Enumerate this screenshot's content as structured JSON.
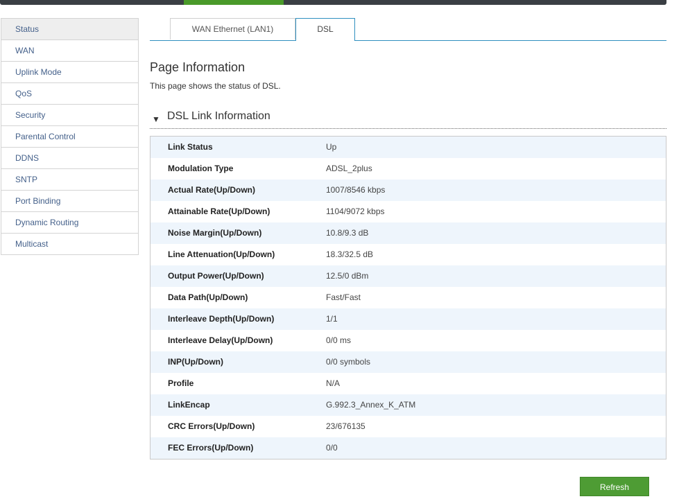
{
  "sidebar": {
    "items": [
      {
        "label": "Status"
      },
      {
        "label": "WAN"
      },
      {
        "label": "Uplink Mode"
      },
      {
        "label": "QoS"
      },
      {
        "label": "Security"
      },
      {
        "label": "Parental Control"
      },
      {
        "label": "DDNS"
      },
      {
        "label": "SNTP"
      },
      {
        "label": "Port Binding"
      },
      {
        "label": "Dynamic Routing"
      },
      {
        "label": "Multicast"
      }
    ]
  },
  "tabs": [
    {
      "label": "WAN Ethernet (LAN1)"
    },
    {
      "label": "DSL"
    }
  ],
  "page": {
    "title": "Page Information",
    "description": "This page shows the status of DSL."
  },
  "section": {
    "title": "DSL Link Information",
    "arrow": "▼"
  },
  "dsl_info": [
    {
      "label": "Link Status",
      "value": "Up"
    },
    {
      "label": "Modulation Type",
      "value": "ADSL_2plus"
    },
    {
      "label": "Actual Rate(Up/Down)",
      "value": "1007/8546 kbps"
    },
    {
      "label": "Attainable Rate(Up/Down)",
      "value": "1104/9072 kbps"
    },
    {
      "label": "Noise Margin(Up/Down)",
      "value": "10.8/9.3 dB"
    },
    {
      "label": "Line Attenuation(Up/Down)",
      "value": "18.3/32.5 dB"
    },
    {
      "label": "Output Power(Up/Down)",
      "value": "12.5/0 dBm"
    },
    {
      "label": "Data Path(Up/Down)",
      "value": "Fast/Fast"
    },
    {
      "label": "Interleave Depth(Up/Down)",
      "value": "1/1"
    },
    {
      "label": "Interleave Delay(Up/Down)",
      "value": "0/0 ms"
    },
    {
      "label": "INP(Up/Down)",
      "value": "0/0 symbols"
    },
    {
      "label": "Profile",
      "value": "N/A"
    },
    {
      "label": "LinkEncap",
      "value": "G.992.3_Annex_K_ATM"
    },
    {
      "label": "CRC Errors(Up/Down)",
      "value": "23/676135"
    },
    {
      "label": "FEC Errors(Up/Down)",
      "value": "0/0"
    }
  ],
  "buttons": {
    "refresh": "Refresh"
  },
  "colors": {
    "accent_green": "#4a9a2a",
    "tab_blue": "#2e8fbf",
    "row_alt": "#eef5fc"
  }
}
